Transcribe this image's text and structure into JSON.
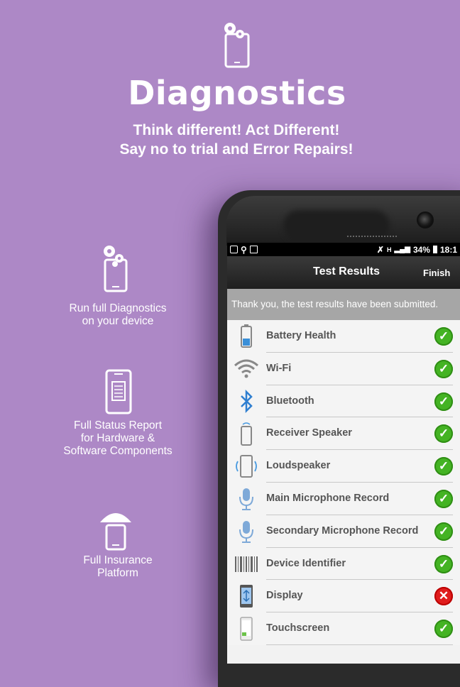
{
  "header": {
    "title": "Diagnostics",
    "tagline_line1": "Think different! Act Different!",
    "tagline_line2": "Say no to trial and Error Repairs!",
    "icon": "phone-gears-icon"
  },
  "features": [
    {
      "icon": "phone-gears-icon",
      "line1": "Run full Diagnostics",
      "line2": "on your device",
      "line3": ""
    },
    {
      "icon": "phone-report-icon",
      "line1": "Full Status Report",
      "line2": "for Hardware &",
      "line3": "Software Components"
    },
    {
      "icon": "phone-umbrella-icon",
      "line1": "Full Insurance",
      "line2": "Platform",
      "line3": ""
    }
  ],
  "statusbar": {
    "battery": "34%",
    "time": "18:1",
    "network": "H"
  },
  "app": {
    "title": "Test Results",
    "finish_label": "Finish",
    "notice": "Thank you, the test results have been submitted."
  },
  "tests": [
    {
      "label": "Battery Health",
      "icon": "battery-icon",
      "status": "pass"
    },
    {
      "label": "Wi-Fi",
      "icon": "wifi-icon",
      "status": "pass"
    },
    {
      "label": "Bluetooth",
      "icon": "bluetooth-icon",
      "status": "pass"
    },
    {
      "label": "Receiver Speaker",
      "icon": "receiver-speaker-icon",
      "status": "pass"
    },
    {
      "label": "Loudspeaker",
      "icon": "loudspeaker-icon",
      "status": "pass"
    },
    {
      "label": "Main Microphone Record",
      "icon": "microphone-icon",
      "status": "pass"
    },
    {
      "label": "Secondary Microphone Record",
      "icon": "microphone-icon",
      "status": "pass"
    },
    {
      "label": "Device Identifier",
      "icon": "barcode-icon",
      "status": "pass"
    },
    {
      "label": "Display",
      "icon": "display-icon",
      "status": "fail"
    },
    {
      "label": "Touchscreen",
      "icon": "touchscreen-icon",
      "status": "pass"
    }
  ],
  "colors": {
    "background": "#ad88c6",
    "pass": "#44b323",
    "fail": "#e01c1c"
  }
}
